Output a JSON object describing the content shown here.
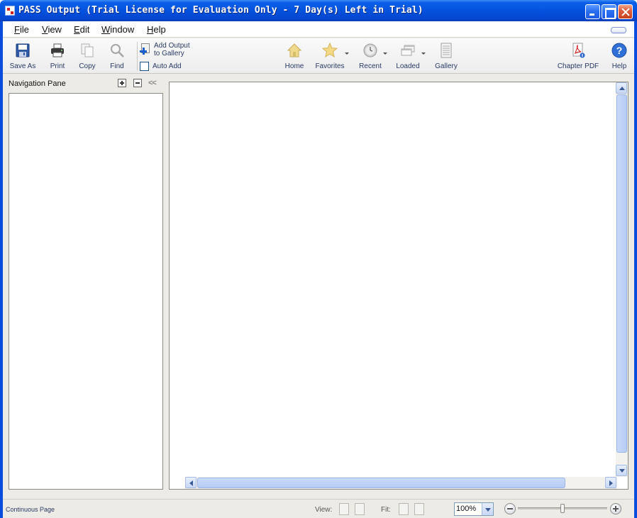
{
  "window": {
    "title": "PASS Output (Trial License for Evaluation Only - 7 Day(s) Left in Trial)"
  },
  "menu": [
    {
      "first": "F",
      "rest": "ile"
    },
    {
      "first": "V",
      "rest": "iew"
    },
    {
      "first": "E",
      "rest": "dit"
    },
    {
      "first": "W",
      "rest": "indow"
    },
    {
      "first": "H",
      "rest": "elp"
    }
  ],
  "toolbar": {
    "save_as": "Save As",
    "print": "Print",
    "copy": "Copy",
    "find": "Find",
    "add_output_line1": "Add Output",
    "add_output_line2": "to Gallery",
    "auto_add": "Auto Add",
    "home": "Home",
    "favorites": "Favorites",
    "recent": "Recent",
    "loaded": "Loaded",
    "gallery": "Gallery",
    "chapter_pdf": "Chapter PDF",
    "help": "Help"
  },
  "nav_pane": {
    "title": "Navigation Pane",
    "collapse": "<<"
  },
  "status": {
    "mode": "Continuous Page",
    "view_label": "View:",
    "fit_label": "Fit:",
    "zoom": "100%",
    "zoom_level": 0.5
  },
  "colors": {
    "title_bar": "#0453de",
    "accent": "#1d5fcc"
  }
}
